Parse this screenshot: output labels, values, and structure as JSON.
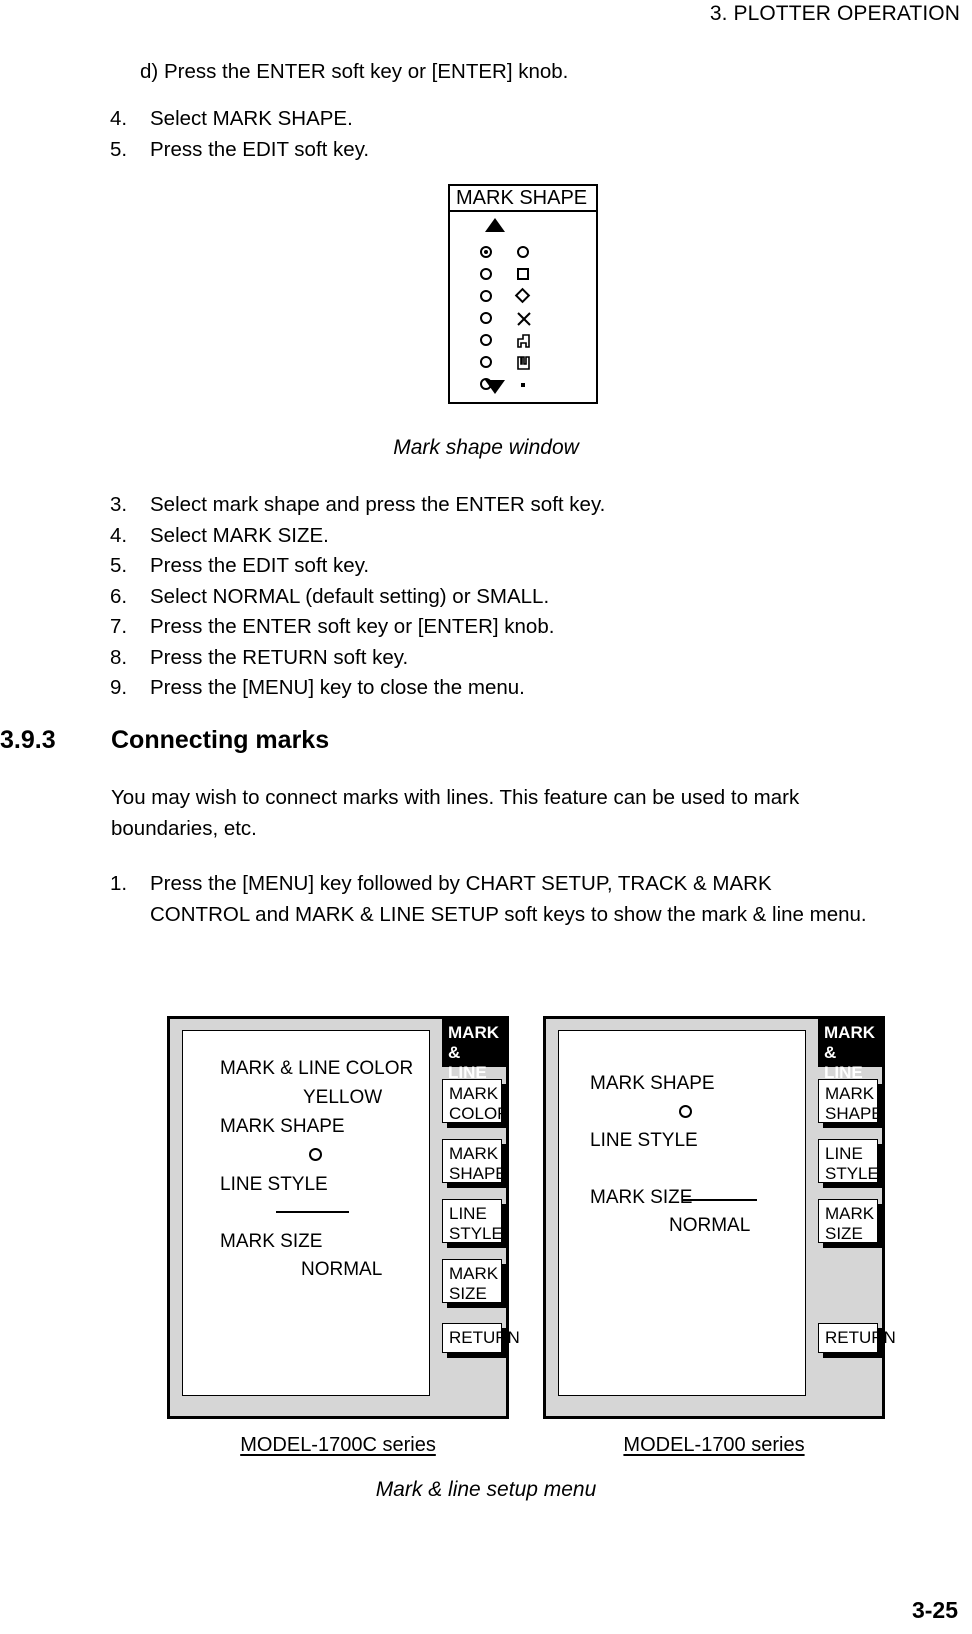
{
  "header": {
    "running_title": "3. PLOTTER OPERATION"
  },
  "page_number": "3-25",
  "sub_step": {
    "marker": "d)",
    "text": "Press the ENTER soft key or [ENTER] knob."
  },
  "steps_top": [
    {
      "num": "4.",
      "text": "Select MARK SHAPE."
    },
    {
      "num": "5.",
      "text": "Press the EDIT soft key."
    }
  ],
  "mark_shape_window": {
    "title": "MARK SHAPE",
    "scroll_up_icon": "triangle-up-icon",
    "scroll_down_icon": "triangle-down-icon",
    "rows": [
      {
        "selected": true,
        "shape": "circle-outline"
      },
      {
        "selected": false,
        "shape": "square-outline"
      },
      {
        "selected": false,
        "shape": "diamond-outline"
      },
      {
        "selected": false,
        "shape": "cross"
      },
      {
        "selected": false,
        "shape": "flag-up"
      },
      {
        "selected": false,
        "shape": "flag-down"
      },
      {
        "selected": false,
        "shape": "dot"
      }
    ]
  },
  "figure_caption_1": "Mark shape window",
  "steps_mid": [
    {
      "num": "3.",
      "text": "Select mark shape and press the ENTER soft key."
    },
    {
      "num": "4.",
      "text": "Select MARK SIZE."
    },
    {
      "num": "5.",
      "text": "Press the EDIT soft key."
    },
    {
      "num": "6.",
      "text": "Select NORMAL (default setting) or SMALL."
    },
    {
      "num": "7.",
      "text": "Press the ENTER soft key or [ENTER] knob."
    },
    {
      "num": "8.",
      "text": "Press the RETURN soft key."
    },
    {
      "num": "9.",
      "text": "Press the [MENU] key to close the menu."
    }
  ],
  "section": {
    "number": "3.9.3",
    "title": "Connecting marks",
    "paragraph": "You may wish to connect marks with lines. This feature can be used to mark boundaries, etc."
  },
  "steps_bottom": [
    {
      "num": "1.",
      "text": "Press the [MENU] key followed by CHART SETUP, TRACK & MARK CONTROL and MARK & LINE SETUP soft keys to show the mark & line menu."
    }
  ],
  "menu_left": {
    "caption": "MODEL-1700C series",
    "items": [
      {
        "label": "MARK & LINE COLOR",
        "value": "YELLOW",
        "value_kind": "text"
      },
      {
        "label": "MARK SHAPE",
        "value": "",
        "value_kind": "circle"
      },
      {
        "label": "LINE STYLE",
        "value": "",
        "value_kind": "solidline"
      },
      {
        "label": "MARK SIZE",
        "value": "NORMAL",
        "value_kind": "text"
      }
    ],
    "softkey_title": "MARK &\nLINE",
    "softkeys": [
      "MARK\nCOLOR",
      "MARK\nSHAPE",
      "LINE\nSTYLE",
      "MARK\nSIZE"
    ],
    "return_key": "RETURN"
  },
  "menu_right": {
    "caption": "MODEL-1700 series",
    "items": [
      {
        "label": "MARK SHAPE",
        "value": "",
        "value_kind": "circle"
      },
      {
        "label": "LINE STYLE",
        "value": "",
        "value_kind": "none"
      },
      {
        "label": "MARK SIZE",
        "value": "NORMAL",
        "value_kind": "text-with-line"
      }
    ],
    "softkey_title": "MARK &\nLINE",
    "softkeys": [
      "MARK\nSHAPE",
      "LINE\nSTYLE",
      "MARK\nSIZE"
    ],
    "return_key": "RETURN"
  },
  "figure_caption_2": "Mark & line setup menu"
}
